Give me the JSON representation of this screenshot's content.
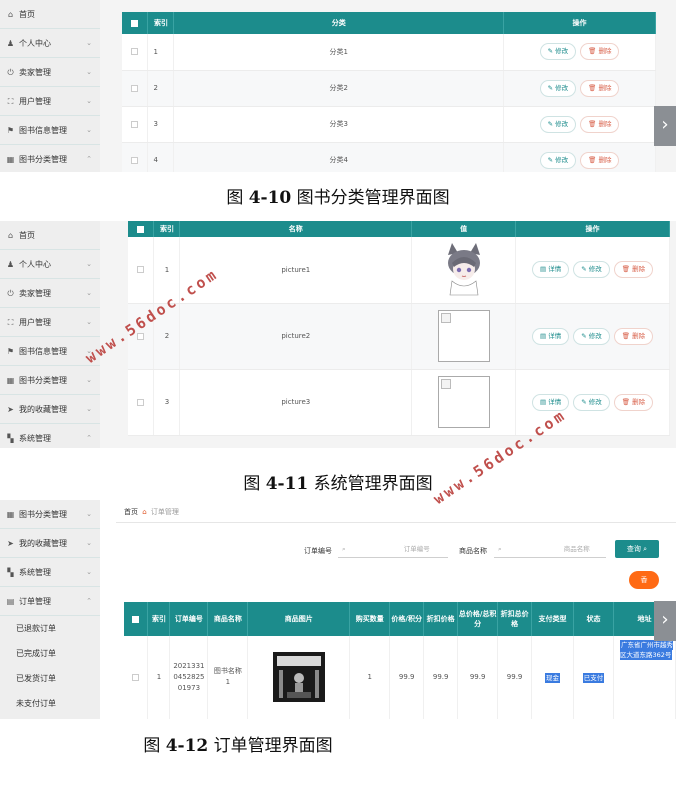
{
  "fig10": {
    "sidebar": [
      {
        "label": "首页",
        "icon": "home-icon",
        "glyph": "⌂",
        "chev": ""
      },
      {
        "label": "个人中心",
        "icon": "user-icon",
        "glyph": "♟",
        "chev": "⌄"
      },
      {
        "label": "卖家管理",
        "icon": "power-icon",
        "glyph": "⏻",
        "chev": "⌄"
      },
      {
        "label": "用户管理",
        "icon": "expand-icon",
        "glyph": "⛶",
        "chev": "⌄"
      },
      {
        "label": "图书信息管理",
        "icon": "flag-icon",
        "glyph": "⚑",
        "chev": "⌄"
      },
      {
        "label": "图书分类管理",
        "icon": "calendar-icon",
        "glyph": "▦",
        "chev": "⌃"
      }
    ],
    "headers": [
      "",
      "索引",
      "分类",
      "操作"
    ],
    "rows": [
      {
        "idx": "1",
        "name": "分类1"
      },
      {
        "idx": "2",
        "name": "分类2"
      },
      {
        "idx": "3",
        "name": "分类3"
      },
      {
        "idx": "4",
        "name": "分类4"
      }
    ],
    "edit_label": "修改",
    "delete_label": "删除",
    "caption_prefix": "图 ",
    "caption_num": "4-10",
    "caption_text": " 图书分类管理界面图"
  },
  "fig11": {
    "sidebar": [
      {
        "label": "首页",
        "icon": "home-icon",
        "glyph": "⌂",
        "chev": ""
      },
      {
        "label": "个人中心",
        "icon": "user-icon",
        "glyph": "♟",
        "chev": "⌄"
      },
      {
        "label": "卖家管理",
        "icon": "power-icon",
        "glyph": "⏻",
        "chev": "⌄"
      },
      {
        "label": "用户管理",
        "icon": "expand-icon",
        "glyph": "⛶",
        "chev": "⌄"
      },
      {
        "label": "图书信息管理",
        "icon": "flag-icon",
        "glyph": "⚑",
        "chev": "⌄"
      },
      {
        "label": "图书分类管理",
        "icon": "calendar-icon",
        "glyph": "▦",
        "chev": "⌄"
      },
      {
        "label": "我的收藏管理",
        "icon": "send-icon",
        "glyph": "➤",
        "chev": "⌄"
      },
      {
        "label": "系统管理",
        "icon": "grid-icon",
        "glyph": "▚",
        "chev": "⌃"
      }
    ],
    "headers": [
      "",
      "索引",
      "名称",
      "值",
      "操作"
    ],
    "rows": [
      {
        "idx": "1",
        "name": "picture1",
        "img": "cartoon"
      },
      {
        "idx": "2",
        "name": "picture2",
        "img": "broken"
      },
      {
        "idx": "3",
        "name": "picture3",
        "img": "broken"
      }
    ],
    "detail_label": "详情",
    "edit_label": "修改",
    "delete_label": "删除",
    "caption_prefix": "图 ",
    "caption_num": "4-11",
    "caption_text": " 系统管理界面图"
  },
  "fig12": {
    "sidebar": [
      {
        "label": "图书分类管理",
        "icon": "calendar-icon",
        "glyph": "▦",
        "chev": "⌄"
      },
      {
        "label": "我的收藏管理",
        "icon": "send-icon",
        "glyph": "➤",
        "chev": "⌄"
      },
      {
        "label": "系统管理",
        "icon": "grid-icon",
        "glyph": "▚",
        "chev": "⌄"
      },
      {
        "label": "订单管理",
        "icon": "order-icon",
        "glyph": "▤",
        "chev": "⌃"
      }
    ],
    "sub_items": [
      "已退款订单",
      "已完成订单",
      "已发货订单",
      "未支付订单"
    ],
    "breadcrumb": {
      "home": "首页",
      "current": "订单管理"
    },
    "search": {
      "order_no_label": "订单编号",
      "order_no_placeholder": "订单编号",
      "product_label": "商品名称",
      "product_placeholder": "商品名称",
      "query_label": "查询"
    },
    "delete_button": "香",
    "headers": [
      "",
      "索引",
      "订单编号",
      "商品名称",
      "商品图片",
      "购买数量",
      "价格/积分",
      "折扣价格",
      "总价格/总积分",
      "折扣总价格",
      "支付类型",
      "状态",
      "地址"
    ],
    "row": {
      "idx": "1",
      "order_no": "20213310452825 01973",
      "product": "图书名称1",
      "qty": "1",
      "price": "99.9",
      "discount_price": "99.9",
      "total": "99.9",
      "discount_total": "99.9",
      "pay_type": "现金",
      "status": "已支付",
      "address": "广东省广州市越秀区大道东路362号"
    },
    "caption_prefix": "图 ",
    "caption_num": "4-12",
    "caption_text": " 订单管理界面图"
  },
  "watermark_text": "www.56doc.com"
}
